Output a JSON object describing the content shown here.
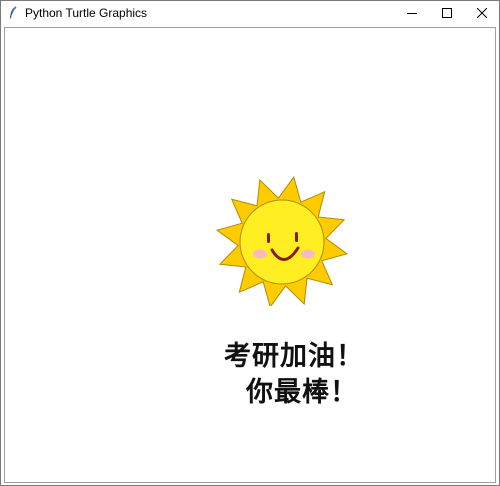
{
  "window": {
    "title": "Python Turtle Graphics",
    "icon": "python-feather-icon",
    "controls": {
      "minimize": "minimize-icon",
      "maximize": "maximize-icon",
      "close": "close-icon"
    }
  },
  "canvas": {
    "drawing": "smiling-sun",
    "colors": {
      "rays": "#ffcc00",
      "face": "#ffee22",
      "outline": "#b08a00",
      "cheeks": "#f7b9c4",
      "features": "#8b1a1a"
    },
    "message_line1": "考研加油！",
    "message_line2": "你最棒！"
  }
}
